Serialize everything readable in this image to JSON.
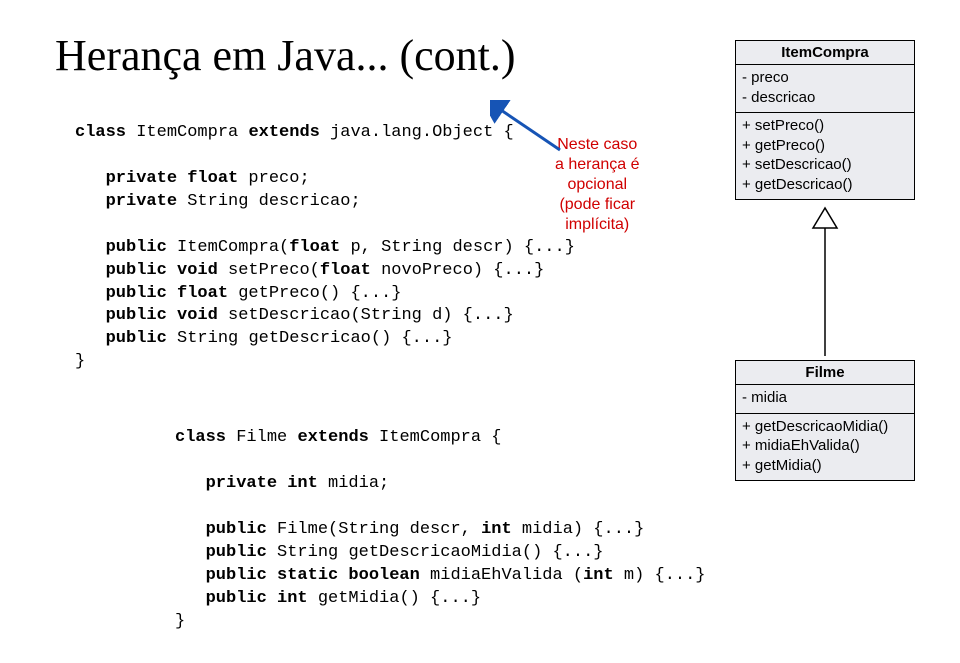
{
  "title": "Herança em Java... (cont.)",
  "code1": {
    "l1a": "class",
    "l1b": " ItemCompra ",
    "l1c": "extends",
    "l1d": " java.lang.Object {",
    "l2a": "   private float",
    "l2b": " preco;",
    "l3a": "   private",
    "l3b": " String descricao;",
    "l4a": "   public",
    "l4b": " ItemCompra(",
    "l4c": "float",
    "l4d": " p, String descr) {...}",
    "l5a": "   public void",
    "l5b": " setPreco(",
    "l5c": "float",
    "l5d": " novoPreco) {...}",
    "l6a": "   public float",
    "l6b": " getPreco() {...}",
    "l7a": "   public void",
    "l7b": " setDescricao(String d) {...}",
    "l8a": "   public",
    "l8b": " String getDescricao() {...}",
    "l9": "}"
  },
  "annot": {
    "l1": "Neste caso",
    "l2": "a herança é",
    "l3": "opcional",
    "l4": "(pode ficar",
    "l5": "implícita)"
  },
  "uml1": {
    "name": "ItemCompra",
    "a1": "- preco",
    "a2": "- descricao",
    "m1": "+ setPreco()",
    "m2": "+ getPreco()",
    "m3": "+ setDescricao()",
    "m4": "+ getDescricao()"
  },
  "code2": {
    "l1a": "class",
    "l1b": " Filme ",
    "l1c": "extends",
    "l1d": " ItemCompra {",
    "l2a": "   private int",
    "l2b": " midia;",
    "l3a": "   public",
    "l3b": " Filme(String descr, ",
    "l3c": "int",
    "l3d": " midia) {...}",
    "l4a": "   public",
    "l4b": " String getDescricaoMidia() {...}",
    "l5a": "   public static boolean",
    "l5b": " midiaEhValida (",
    "l5c": "int",
    "l5d": " m) {...}",
    "l6a": "   public int",
    "l6b": " getMidia() {...}",
    "l7": "}"
  },
  "uml2": {
    "name": "Filme",
    "a1": "- midia",
    "m1": "+ getDescricaoMidia()",
    "m2": "+ midiaEhValida()",
    "m3": "+ getMidia()"
  }
}
